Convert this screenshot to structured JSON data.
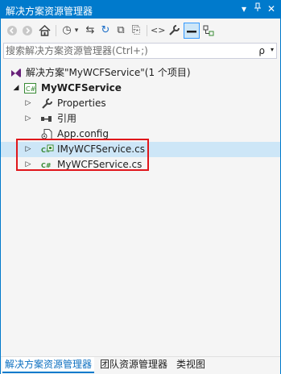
{
  "window": {
    "title": "解决方案资源管理器",
    "dropdown_glyph": "▾",
    "pin_glyph": "ꟷ",
    "close_glyph": "✕"
  },
  "toolbar": {
    "back_icon": "◀",
    "forward_icon": "▶",
    "home_icon": "⌂",
    "history_icon": "◷",
    "history_dropdown": "▾",
    "sync_icon": "⇆",
    "refresh_icon": "↻",
    "collapse_icon": "⧉",
    "copy_icon": "⎘",
    "view_code_icon": "<>",
    "properties_icon": "🔧",
    "preview_icon": "▬",
    "diagram_icon": "⌗"
  },
  "search": {
    "placeholder": "搜索解决方案资源管理器(Ctrl+;)",
    "search_glyph": "ρ",
    "dropdown_glyph": "▾"
  },
  "tree": {
    "solution_label": "解决方案\"MyWCFService\"(1 个项目)",
    "project_label": "MyWCFService",
    "items": [
      {
        "label": "Properties"
      },
      {
        "label": "引用"
      },
      {
        "label": "App.config"
      },
      {
        "label": "IMyWCFService.cs"
      },
      {
        "label": "MyWCFService.cs"
      }
    ],
    "cs_badge": "C#"
  },
  "tabs": [
    {
      "label": "解决方案资源管理器"
    },
    {
      "label": "团队资源管理器"
    },
    {
      "label": "类视图"
    }
  ],
  "colors": {
    "accent": "#007acc",
    "highlight_box": "#e0161b",
    "selection": "#cde6f7"
  }
}
